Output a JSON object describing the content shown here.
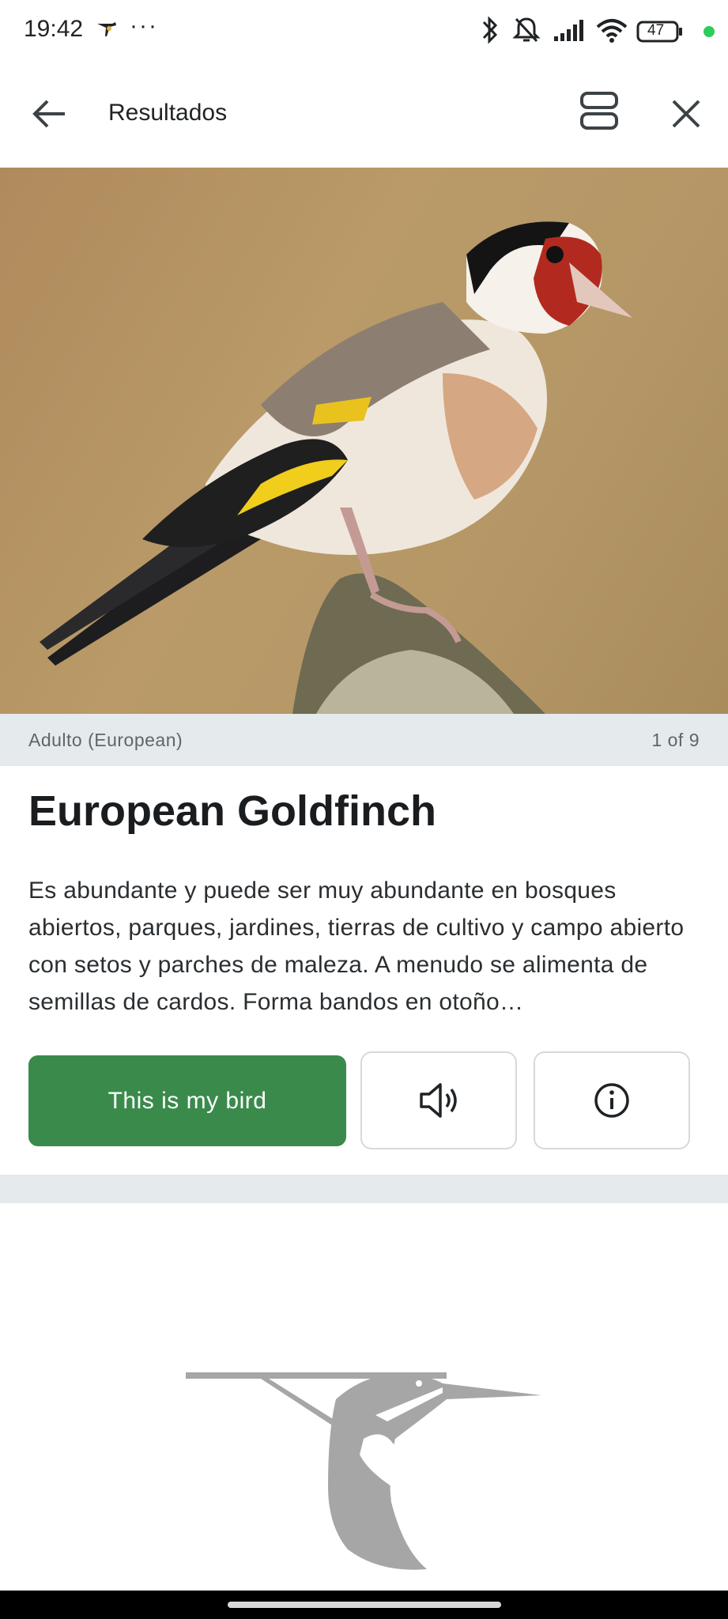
{
  "status_bar": {
    "time": "19:42",
    "more": "···",
    "battery": "47",
    "icons": [
      "bird-app-icon",
      "bluetooth-icon",
      "mute-icon",
      "signal-icon",
      "wifi-icon",
      "battery-icon",
      "dot-indicator"
    ]
  },
  "app_bar": {
    "title": "Resultados",
    "icons": [
      "back-arrow-icon",
      "layout-toggle-icon",
      "close-icon"
    ]
  },
  "result": {
    "caption": "Adulto (European)",
    "counter": "1 of 9",
    "name": "European Goldfinch",
    "description": "Es abundante y puede ser muy abundante en bosques abiertos, parques, jardines, tierras de cultivo y campo abierto con setos y parches de maleza. A menudo se alimenta de semillas de cardos. Forma bandos en otoño…",
    "primary_button": "This is my bird",
    "icons": [
      "sound-icon",
      "info-icon"
    ]
  },
  "colors": {
    "primary": "#3a8a4c",
    "caption_bg": "#e5eaec",
    "logo": "#a6a6a6"
  }
}
